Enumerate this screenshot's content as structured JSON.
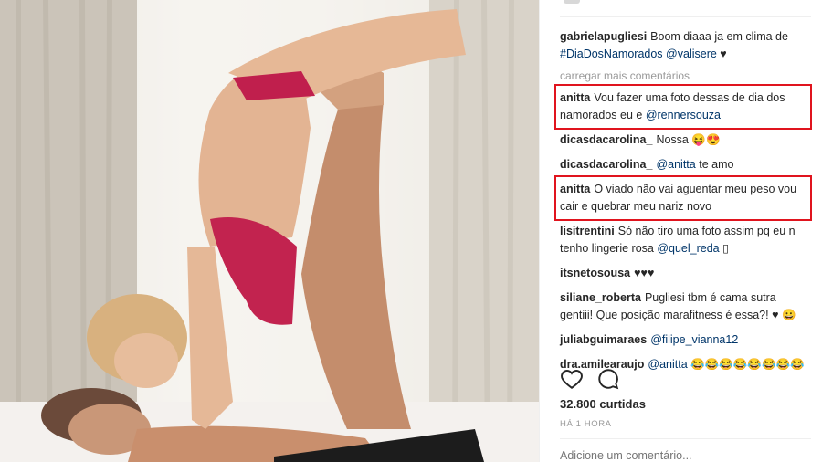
{
  "post": {
    "caption": {
      "user": "gabrielapugliesi",
      "text": "Boom diaaa ja em clima de",
      "hashtag": "#DiaDosNamorados",
      "mention": "@valisere",
      "emoji": "♥"
    },
    "load_more": "carregar mais comentários",
    "comments": [
      {
        "user": "anitta",
        "text": "Vou fazer uma foto dessas de dia dos namorados eu e",
        "mention": "@rennersouza",
        "emoji": ""
      },
      {
        "user": "dicasdacarolina_",
        "text": "Nossa",
        "mention": "",
        "emoji": "😝😍"
      },
      {
        "user": "dicasdacarolina_",
        "text": "",
        "mention": "@anitta",
        "emoji": "te amo"
      },
      {
        "user": "anitta",
        "text": "O viado não vai aguentar meu peso vou cair e quebrar meu nariz novo",
        "mention": "",
        "emoji": ""
      },
      {
        "user": "lisitrentini",
        "text": "Só não tiro uma foto assim pq eu n tenho lingerie rosa",
        "mention": "@quel_reda",
        "emoji": "▯"
      },
      {
        "user": "itsnetosousa",
        "text": "",
        "mention": "",
        "emoji": "♥♥♥"
      },
      {
        "user": "siliane_roberta",
        "text": "Pugliesi tbm é cama sutra gentiii! Que posição marafitness é essa?!",
        "mention": "",
        "emoji": "♥ 😀"
      },
      {
        "user": "juliabguimaraes",
        "text": "",
        "mention": "@filipe_vianna12",
        "emoji": ""
      },
      {
        "user": "dra.amilearaujo",
        "text": "",
        "mention": "@anitta",
        "emoji": "😂😂😂😂😂😂😂😂"
      }
    ],
    "likes": "32.800 curtidas",
    "time": "HÁ 1 HORA",
    "add_comment_placeholder": "Adicione um comentário..."
  },
  "colors": {
    "highlight": "#e0141e",
    "link": "#003569",
    "muted": "#999999"
  },
  "icons": [
    "heart-icon",
    "comment-icon"
  ]
}
